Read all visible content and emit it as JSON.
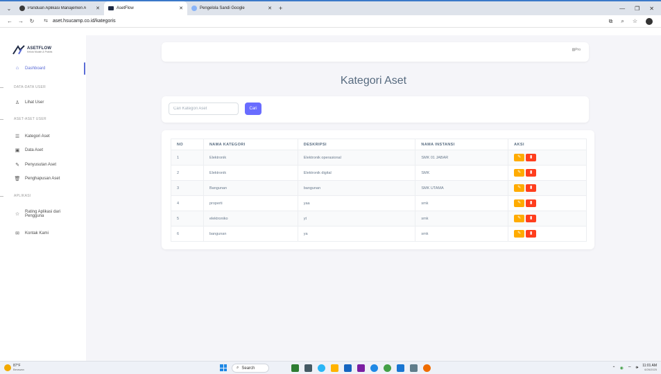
{
  "browser": {
    "tabs": [
      {
        "label": "Panduan Aplikasi Manajemen A",
        "active": false,
        "icon_color": "#3a3a3a"
      },
      {
        "label": "AsetFlow",
        "active": true,
        "icon_color": "#1f2a44"
      },
      {
        "label": "Pengelola Sandi Google",
        "active": false,
        "icon_color": "#8ab4f8"
      }
    ],
    "new_tab": "+",
    "url": "aset.hsucamp.co.id/kategoris"
  },
  "sidebar": {
    "brand_name": "ASETFLOW",
    "brand_tagline": "Kelola Mudah & Praktis",
    "dashboard": "Dashboard",
    "section_user": "DATA-DATA USER",
    "lihat_user": "Lihat User",
    "section_aset": "ASET-ASET USER",
    "kategori_aset": "Kategori Aset",
    "data_aset": "Data Aset",
    "penyusutan_aset": "Penyusutan Aset",
    "penghapusan_aset": "Penghapusan Aset",
    "section_aplikasi": "APLIKASI",
    "rating_line1": "Rating Aplikasi dari",
    "rating_line2": "Pengguna",
    "kontak_kami": "Kontak Kami"
  },
  "topbar": {
    "avatar_alt": "Pro"
  },
  "page": {
    "title": "Kategori Aset",
    "search_placeholder": "Cari Kategori Aset",
    "search_button": "Cari"
  },
  "table": {
    "headers": {
      "no": "NO",
      "nama": "NAMA KATEGORI",
      "deskripsi": "DESKRIPSI",
      "instansi": "NAMA INSTANSI",
      "aksi": "AKSI"
    },
    "rows": [
      {
        "no": "1",
        "nama": "Elektronik",
        "deskripsi": "Elektronik operasional",
        "instansi": "SMK 01 JABAR"
      },
      {
        "no": "2",
        "nama": "Elektronik",
        "deskripsi": "Elektronik digital",
        "instansi": "SMK"
      },
      {
        "no": "3",
        "nama": "Bangunan",
        "deskripsi": "bangunan",
        "instansi": "SMK UTAMA"
      },
      {
        "no": "4",
        "nama": "properti",
        "deskripsi": "yaa",
        "instansi": "smk"
      },
      {
        "no": "5",
        "nama": "elektroniko",
        "deskripsi": "yt",
        "instansi": "smk"
      },
      {
        "no": "6",
        "nama": "bangunan",
        "deskripsi": "ya",
        "instansi": "smk"
      }
    ]
  },
  "taskbar": {
    "temperature": "87°F",
    "weather_sub": "Berawan",
    "search_label": "Search",
    "time": "11:01 AM",
    "date": "6/26/2025"
  },
  "colors": {
    "accent": "#696cff",
    "edit": "#ffab00",
    "delete": "#ff3e1d",
    "sidebar_active": "#5a6bd6"
  }
}
